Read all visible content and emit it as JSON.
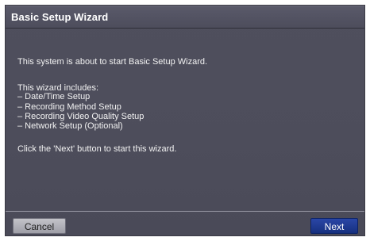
{
  "dialog": {
    "title": "Basic Setup Wizard",
    "intro": "This system is about to start Basic Setup Wizard.",
    "includes_heading": "This wizard includes:",
    "items": [
      "– Date/Time Setup",
      "– Recording Method Setup",
      "– Recording Video Quality Setup",
      "– Network Setup (Optional)"
    ],
    "instruction": "Click the 'Next' button to start this wizard.",
    "buttons": {
      "cancel": "Cancel",
      "next": "Next"
    }
  },
  "colors": {
    "panel": "#4d4d5b",
    "titlebar": "#55556a",
    "next_button": "#1f3a95",
    "cancel_button": "#b1b1b9",
    "text": "#f2f2f2"
  }
}
